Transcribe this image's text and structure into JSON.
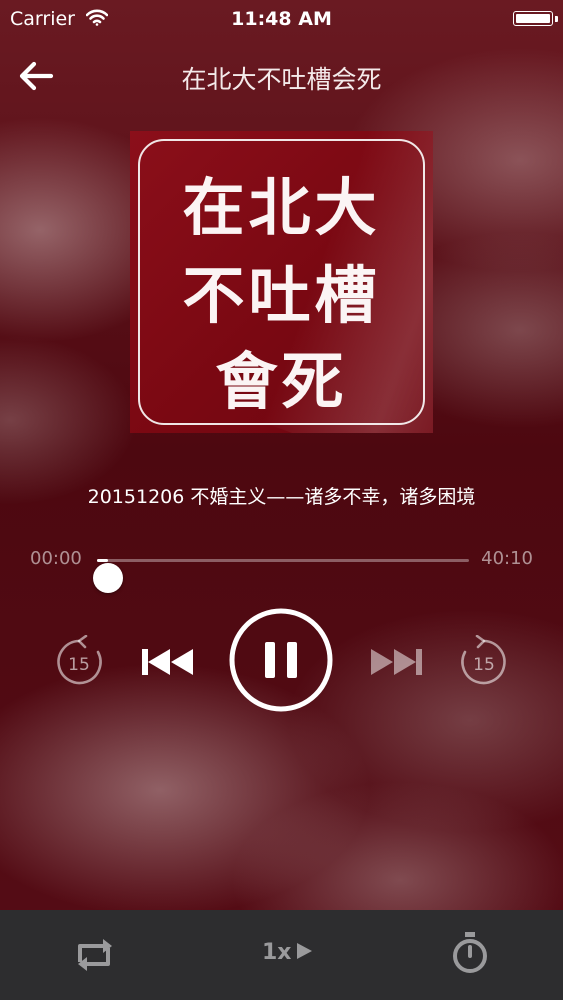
{
  "status_bar": {
    "carrier": "Carrier",
    "time": "11:48 AM"
  },
  "nav": {
    "title": "在北大不吐槽会死",
    "back_icon": "arrow-left-icon"
  },
  "cover": {
    "lines": [
      "在北大",
      "不吐槽",
      "會死"
    ],
    "background": "#7a0812"
  },
  "episode": {
    "title": "20151206 不婚主义——诸多不幸，诸多困境"
  },
  "player": {
    "elapsed": "00:00",
    "duration": "40:10",
    "progress_fraction": 0.03,
    "skip_back_seconds": "15",
    "skip_forward_seconds": "15",
    "state": "playing"
  },
  "bottom_bar": {
    "speed": "1x",
    "repeat_icon": "repeat-icon",
    "timer_icon": "timer-icon"
  }
}
